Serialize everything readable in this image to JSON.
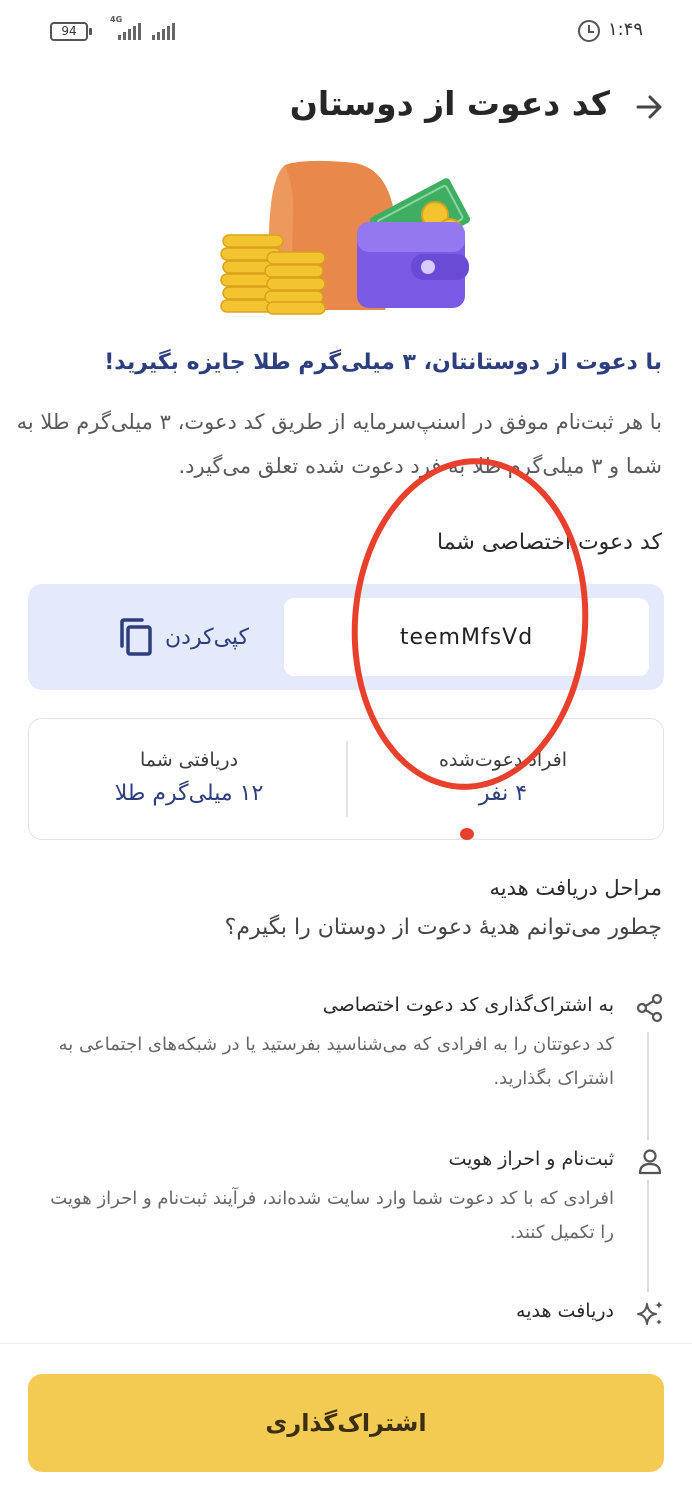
{
  "status_bar": {
    "battery": "94",
    "network_type": "4G",
    "time": "۱:۴۹"
  },
  "header": {
    "title": "کد دعوت از دوستان"
  },
  "promo": {
    "headline": "با دعوت از دوستانتان، ۳ میلی‌گرم طلا جایزه بگیرید!",
    "description": "با هر ثبت‌نام موفق در اسنپ‌سرمایه از طریق کد دعوت، ۳ میلی‌گرم طلا به شما و ۳ میلی‌گرم طلا به فرد دعوت شده تعلق می‌گیرد."
  },
  "referral": {
    "label": "کد دعوت اختصاصی شما",
    "code": "teemMfsVd",
    "copy_label": "کپی‌کردن"
  },
  "stats": {
    "invited_label": "افراد دعوت‌شده",
    "invited_value": "۴ نفر",
    "received_label": "دریافتی شما",
    "received_value": "۱۲ میلی‌گرم طلا"
  },
  "steps": {
    "title": "مراحل دریافت هدیه",
    "subtitle": "چطور می‌توانم هدیهٔ دعوت از دوستان را بگیرم؟",
    "items": [
      {
        "title": "به اشتراک‌گذاری کد دعوت اختصاصی",
        "description": "کد دعوتتان را به افرادی که می‌شناسید بفرستید یا در شبکه‌های اجتماعی به اشتراک بگذارید.",
        "icon": "share-icon"
      },
      {
        "title": "ثبت‌نام و احراز هویت",
        "description": "افرادی که با کد دعوت شما وارد سایت شده‌اند، فرآیند ثبت‌نام و احراز هویت را تکمیل کنند.",
        "icon": "user-icon"
      },
      {
        "title": "دریافت هدیه",
        "icon": "sparkle-icon"
      }
    ]
  },
  "footer": {
    "share_label": "اشتراک‌گذاری"
  },
  "colors": {
    "accent_navy": "#2c3e7e",
    "code_box_bg": "#e4e9fc",
    "share_button": "#f3cb52",
    "annotation_red": "#e8402d"
  }
}
